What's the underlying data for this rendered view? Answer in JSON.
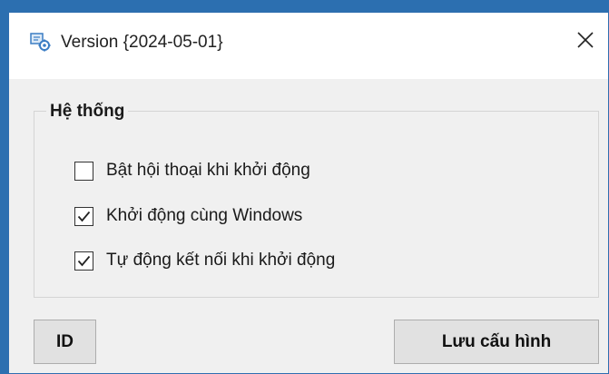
{
  "window": {
    "title": "Version {2024-05-01}",
    "icon": "settings-app-icon",
    "close_icon": "close-icon"
  },
  "group": {
    "label": "Hệ thống",
    "options": [
      {
        "label": "Bật hội thoại khi khởi động",
        "checked": false
      },
      {
        "label": "Khởi động cùng Windows",
        "checked": true
      },
      {
        "label": "Tự động kết nối khi khởi động",
        "checked": true
      }
    ]
  },
  "buttons": {
    "id_label": "ID",
    "save_label": "Lưu cấu hình"
  },
  "colors": {
    "window_border": "#2f6eb0",
    "background": "#f0f0f0",
    "button": "#e1e1e1"
  }
}
